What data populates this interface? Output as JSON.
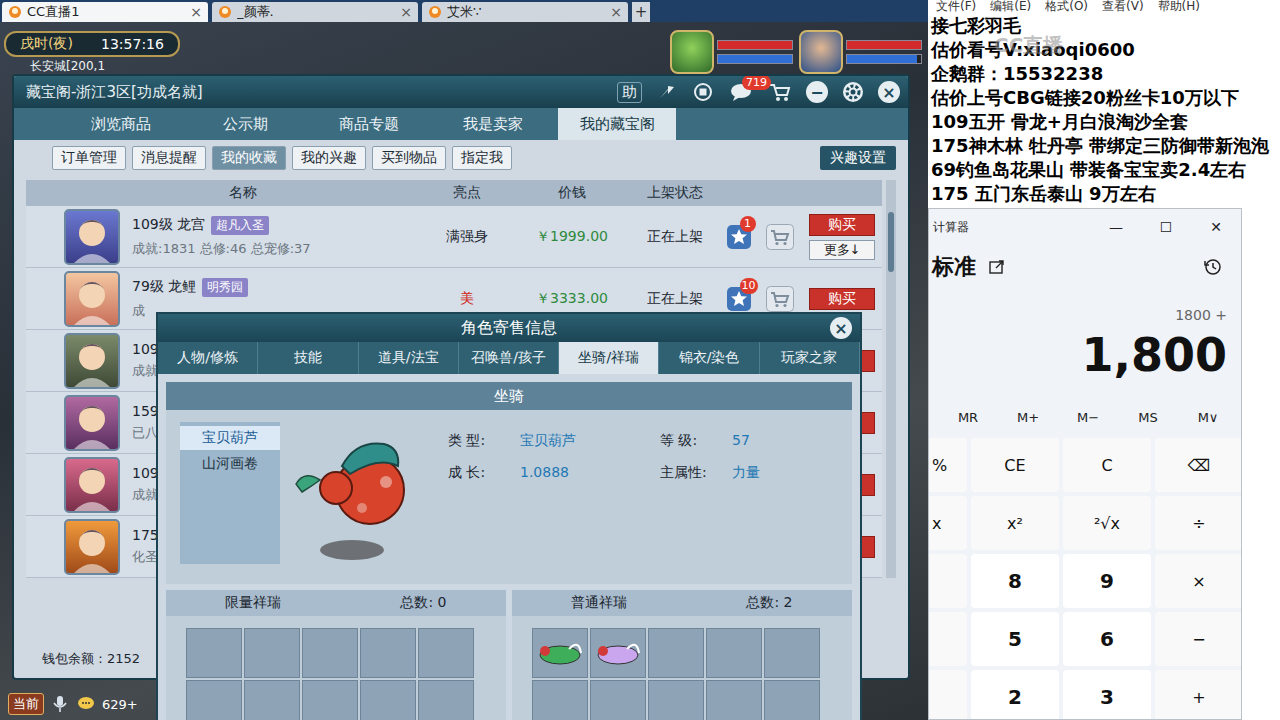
{
  "browser": {
    "tabs": [
      {
        "label": "CC直播1",
        "selected": true,
        "close": "×"
      },
      {
        "label": "_颜蒂.",
        "selected": false,
        "close": "×"
      },
      {
        "label": "艾米∵",
        "selected": false,
        "close": "×"
      }
    ],
    "new_tab": "+"
  },
  "hud": {
    "period": "戌时(夜)",
    "time": "13:57:16",
    "location": "长安城[200,1",
    "party": [
      {
        "hp": 1,
        "mp": 1
      },
      {
        "hp": 1,
        "mp": 0.95
      }
    ]
  },
  "cbg": {
    "title": "藏宝阁-浙江3区[功成名就]",
    "help": "助",
    "chat_badge": "719",
    "minimize": "−",
    "close": "×",
    "tabs": [
      {
        "label": "浏览商品",
        "selected": false
      },
      {
        "label": "公示期",
        "selected": false
      },
      {
        "label": "商品专题",
        "selected": false
      },
      {
        "label": "我是卖家",
        "selected": false
      },
      {
        "label": "我的藏宝阁",
        "selected": true
      }
    ],
    "subtabs": [
      {
        "label": "订单管理",
        "selected": false
      },
      {
        "label": "消息提醒",
        "selected": false
      },
      {
        "label": "我的收藏",
        "selected": true
      },
      {
        "label": "我的兴趣",
        "selected": false
      },
      {
        "label": "买到物品",
        "selected": false
      },
      {
        "label": "指定我",
        "selected": false
      }
    ],
    "interest_button": "兴趣设置",
    "columns": [
      "名称",
      "亮点",
      "价钱",
      "上架状态"
    ],
    "rows": [
      {
        "kind": "full",
        "name": "109级 龙宫",
        "tag": "超凡入圣",
        "details": "成就:1831 总修:46 总宠修:37",
        "highlight": "满强身",
        "highlight_color": "#1c2630",
        "price": "￥1999.00",
        "status": "正在上架",
        "fav_badge": "1",
        "buy": "购买",
        "more": "更多↓"
      },
      {
        "kind": "full",
        "name": "79级 龙鲤",
        "tag": "明秀园",
        "details": "成",
        "highlight": "美",
        "highlight_color": "#d02a20",
        "price": "￥3333.00",
        "status": "正在上架",
        "fav_badge": "10",
        "buy": "购买"
      },
      {
        "kind": "partial",
        "name": "109",
        "details": "成就"
      },
      {
        "kind": "partial",
        "name": "159",
        "details": "已八"
      },
      {
        "kind": "partial",
        "name": "109",
        "details": "成就"
      },
      {
        "kind": "partial",
        "name": "175",
        "details": "化圣"
      }
    ],
    "wallet": "钱包余额：2152"
  },
  "dialog": {
    "title": "角色寄售信息",
    "close": "×",
    "tabs": [
      {
        "label": "人物/修炼",
        "selected": false
      },
      {
        "label": "技能",
        "selected": false
      },
      {
        "label": "道具/法宝",
        "selected": false
      },
      {
        "label": "召唤兽/孩子",
        "selected": false
      },
      {
        "label": "坐骑/祥瑞",
        "selected": true
      },
      {
        "label": "锦衣/染色",
        "selected": false
      },
      {
        "label": "玩家之家",
        "selected": false
      }
    ],
    "section": "坐骑",
    "mounts": [
      {
        "label": "宝贝葫芦",
        "selected": true
      },
      {
        "label": "山河画卷",
        "selected": false
      }
    ],
    "info": [
      {
        "label": "类 型:",
        "value": "宝贝葫芦"
      },
      {
        "label": "等 级:",
        "value": "57"
      },
      {
        "label": "成 长:",
        "value": "1.0888"
      },
      {
        "label": "主属性:",
        "value": "力量"
      }
    ],
    "xiangrui": [
      {
        "title": "限量祥瑞",
        "count_label": "总数:",
        "count": "0",
        "items": []
      },
      {
        "title": "普通祥瑞",
        "count_label": "总数:",
        "count": "2",
        "items": [
          {
            "color": "#3fae5a"
          },
          {
            "color": "#c9a6ee"
          }
        ]
      }
    ]
  },
  "bottom_bar": {
    "channel": "当前",
    "count": "629+"
  },
  "notepad": {
    "menu": [
      "文件(F)",
      "编辑(E)",
      "格式(O)",
      "查看(V)",
      "帮助(H)"
    ],
    "lines": [
      "接七彩羽毛",
      "估价看号V:xiaoqi0600",
      "企鹅群：15532238",
      "估价上号CBG链接20粉丝卡10万以下",
      "109五开 骨龙+月白浪淘沙全套",
      "175神木林 牡丹亭 带绑定三防御带新泡泡",
      "69钓鱼岛花果山 带装备宝宝卖2.4左右",
      "175 五门东岳泰山 9万左右"
    ]
  },
  "watermark": "CC直播",
  "calculator": {
    "title": "计算器",
    "controls": [
      "—",
      "☐",
      "✕"
    ],
    "mode": "标准",
    "expression": "1800 +",
    "display": "1,800",
    "memory": [
      "MR",
      "M+",
      "M−",
      "MS",
      "M∨"
    ],
    "rows": [
      {
        "edge": "%",
        "keys": [
          {
            "label": "CE",
            "kind": "fn"
          },
          {
            "label": "C",
            "kind": "fn"
          },
          {
            "label": "⌫",
            "kind": "fn"
          }
        ]
      },
      {
        "edge": "x",
        "keys": [
          {
            "label": "x²",
            "kind": "fn"
          },
          {
            "label": "²√x",
            "kind": "fn"
          },
          {
            "label": "÷",
            "kind": "fn"
          }
        ]
      },
      {
        "edge": "",
        "keys": [
          {
            "label": "8",
            "kind": "num"
          },
          {
            "label": "9",
            "kind": "num"
          },
          {
            "label": "×",
            "kind": "fn"
          }
        ]
      },
      {
        "edge": "",
        "keys": [
          {
            "label": "5",
            "kind": "num"
          },
          {
            "label": "6",
            "kind": "num"
          },
          {
            "label": "−",
            "kind": "fn"
          }
        ]
      },
      {
        "edge": "",
        "keys": [
          {
            "label": "2",
            "kind": "num"
          },
          {
            "label": "3",
            "kind": "num"
          },
          {
            "label": "+",
            "kind": "fn"
          }
        ]
      }
    ]
  }
}
